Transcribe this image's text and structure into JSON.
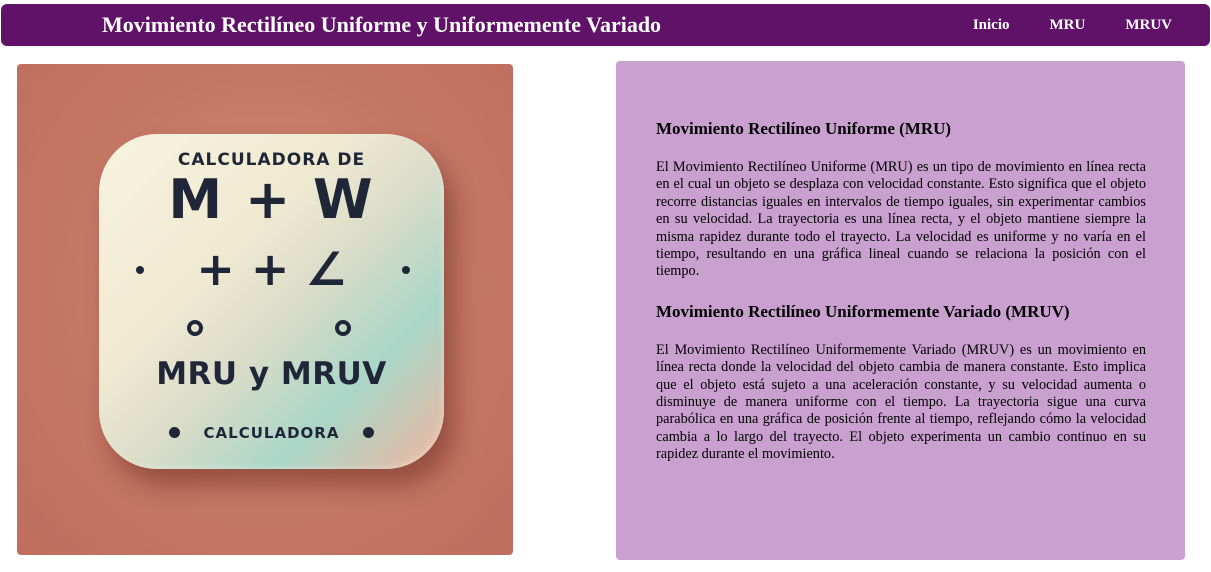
{
  "header": {
    "title": "Movimiento Rectilíneo Uniforme y Uniformemente Variado",
    "nav": [
      {
        "label": "Inicio"
      },
      {
        "label": "MRU"
      },
      {
        "label": "MRUV"
      }
    ]
  },
  "hero_image": {
    "line_top": "CALCULADORA DE",
    "line_formula": "M + W",
    "line_ops": "+ + ∠",
    "line_main": "MRU y MRUV",
    "line_bottom": "CALCULADORA"
  },
  "content": {
    "sections": [
      {
        "heading": "Movimiento Rectilíneo Uniforme (MRU)",
        "text": "El Movimiento Rectilíneo Uniforme (MRU) es un tipo de movimiento en línea recta en el cual un objeto se desplaza con velocidad constante. Esto significa que el objeto recorre distancias iguales en intervalos de tiempo iguales, sin experimentar cambios en su velocidad. La trayectoria es una línea recta, y el objeto mantiene siempre la misma rapidez durante todo el trayecto. La velocidad es uniforme y no varía en el tiempo, resultando en una gráfica lineal cuando se relaciona la posición con el tiempo."
      },
      {
        "heading": "Movimiento Rectilíneo Uniformemente Variado (MRUV)",
        "text": "El Movimiento Rectilíneo Uniformemente Variado (MRUV) es un movimiento en línea recta donde la velocidad del objeto cambia de manera constante. Esto implica que el objeto está sujeto a una aceleración constante, y su velocidad aumenta o disminuye de manera uniforme con el tiempo. La trayectoria sigue una curva parabólica en una gráfica de posición frente al tiempo, reflejando cómo la velocidad cambia a lo largo del trayecto. El objeto experimenta un cambio continuo en su rapidez durante el movimiento."
      }
    ]
  },
  "colors": {
    "navbar": "#5f1268",
    "text_panel": "#c9a0cf",
    "image_background": "#c57765"
  }
}
